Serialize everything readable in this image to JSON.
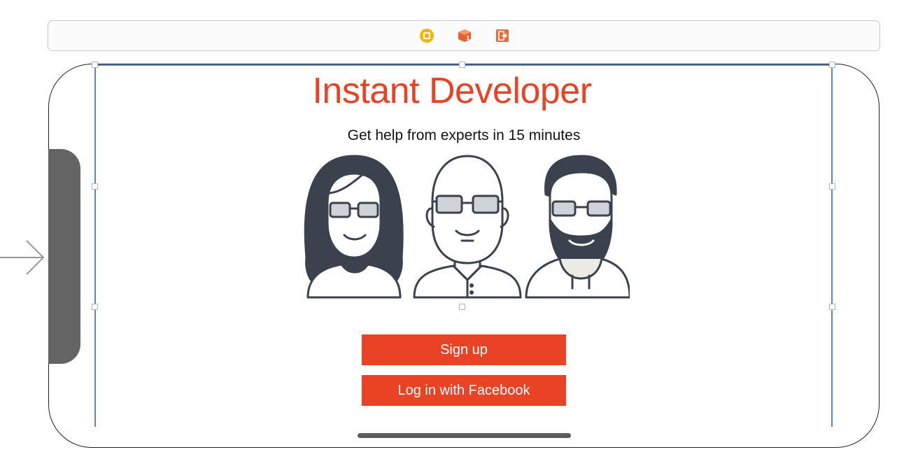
{
  "scene_dock": {
    "icons": [
      "view-controller-icon",
      "first-responder-icon",
      "exit-icon"
    ]
  },
  "app": {
    "title": "Instant Developer",
    "subtitle": "Get help from experts in 15 minutes"
  },
  "buttons": {
    "signup_label": "Sign up",
    "facebook_label": "Log in with Facebook"
  },
  "colors": {
    "accent": "#ea4225",
    "guide": "#5b84c7",
    "illustration_stroke": "#3b424d"
  }
}
